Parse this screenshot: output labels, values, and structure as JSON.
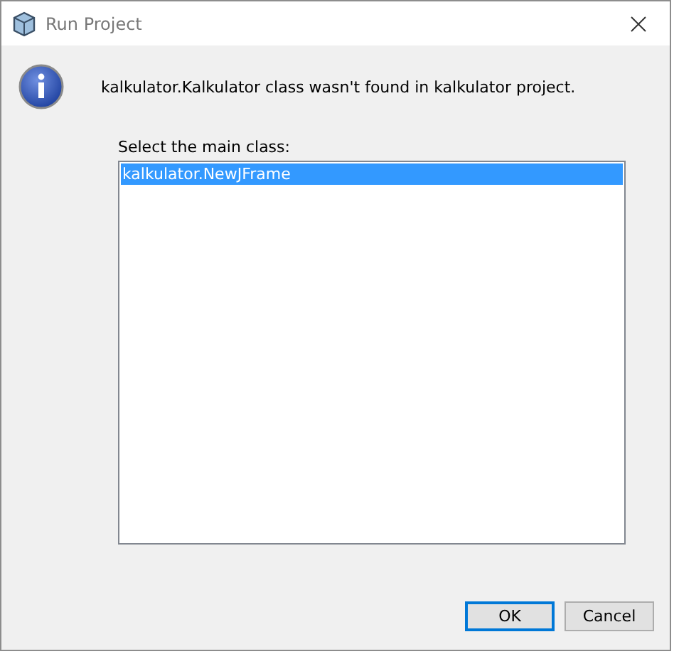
{
  "window": {
    "title": "Run Project"
  },
  "message": "kalkulator.Kalkulator class wasn't found in kalkulator project.",
  "list": {
    "label": "Select the main class:",
    "items": [
      {
        "label": "kalkulator.NewJFrame",
        "selected": true
      }
    ]
  },
  "buttons": [
    {
      "label": "OK",
      "default": true
    },
    {
      "label": "Cancel",
      "default": false
    }
  ]
}
